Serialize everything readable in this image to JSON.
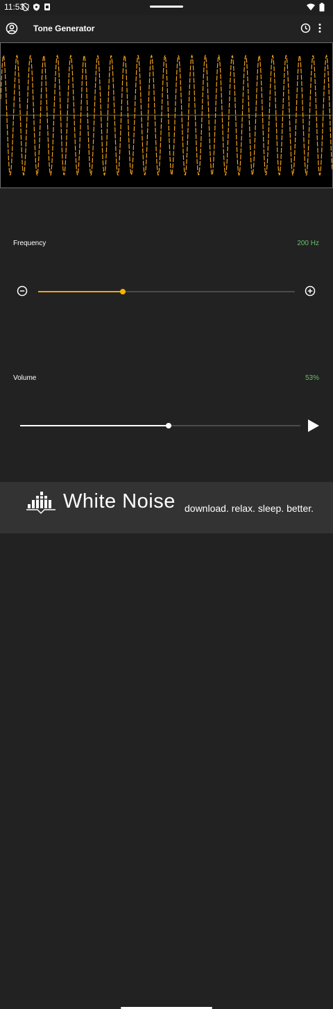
{
  "status_bar": {
    "time": "11:53"
  },
  "app_bar": {
    "title": "Tone Generator"
  },
  "frequency": {
    "label": "Frequency",
    "value": "200 Hz",
    "slider_fraction": 0.33
  },
  "volume": {
    "label": "Volume",
    "value": "53%",
    "slider_fraction": 0.53
  },
  "waveform": {
    "wave_color": "#f3a31a",
    "baseline_color": "#7a6a2a"
  },
  "ad_banner": {
    "brand": "White Noise",
    "tagline": "download. relax. sleep. better."
  },
  "colors": {
    "accent": "#f3a31a",
    "value_text": "#6bbf6b",
    "background": "#222222",
    "banner": "#333333"
  }
}
